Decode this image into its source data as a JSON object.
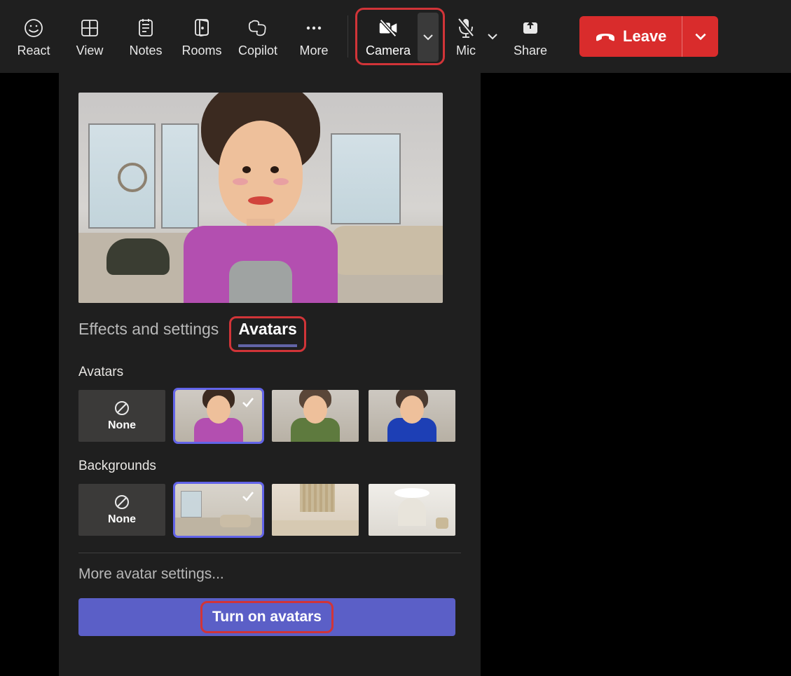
{
  "toolbar": {
    "react": "React",
    "view": "View",
    "notes": "Notes",
    "rooms": "Rooms",
    "copilot": "Copilot",
    "more": "More",
    "camera": "Camera",
    "mic": "Mic",
    "share": "Share",
    "leave": "Leave"
  },
  "panel": {
    "tabs": {
      "effects": "Effects and settings",
      "avatars": "Avatars"
    },
    "avatars_label": "Avatars",
    "none_label": "None",
    "backgrounds_label": "Backgrounds",
    "more_settings": "More avatar settings...",
    "turn_on": "Turn on avatars"
  }
}
